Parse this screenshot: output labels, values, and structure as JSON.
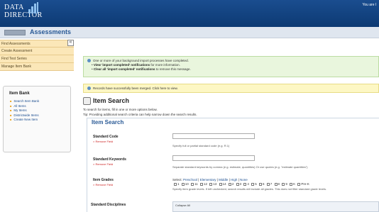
{
  "header": {
    "logo_line1": "DATA",
    "logo_line2": "DIRECTOR",
    "user_text": "You are l"
  },
  "titlebar": {
    "button_label": "",
    "title": "Assessments"
  },
  "sidebar": {
    "items": [
      {
        "label": "Find Assessments"
      },
      {
        "label": "Create Assessment"
      },
      {
        "label": "Find Test Series"
      },
      {
        "label": "Manage Item Bank"
      }
    ],
    "collapse_label": "«",
    "item_bank": {
      "heading": "Item Bank",
      "links": [
        {
          "label": "Search Item Bank"
        },
        {
          "label": "All Items"
        },
        {
          "label": "My Items"
        },
        {
          "label": "Districtwide Items"
        },
        {
          "label": "Create New Item"
        }
      ]
    }
  },
  "notice": {
    "line1": "One or more of your background import processes have completed.",
    "line2_bold": "View 'import completed' notifications",
    "line2_rest": "for more information.",
    "line3_bold": "Clear all 'import completed' notifications",
    "line3_rest": "to remove this message."
  },
  "merged_notice": "Records have successfully been merged. Click here to view.",
  "search": {
    "title": "Item Search",
    "intro1": "To search for items, fill in one or more options below.",
    "intro2": "Tip: Providing additional search criteria can help narrow down the search results.",
    "panel_title": "Item Search",
    "remove_label": "× Remove Field",
    "standard_code": {
      "label": "Standard Code",
      "hint": "Specify full or partial standard code (e.g. R.1)"
    },
    "standard_keywords": {
      "label": "Standard Keywords",
      "hint": "Separate standard keywords by comma (e.g. estimate, quantities) Or use quotes (e.g. \"estimate quantities\")"
    },
    "item_grades": {
      "label": "Item Grades",
      "select_prefix": "Select:",
      "select_links": [
        "Preschool",
        "Elementary",
        "Middle",
        "High",
        "None"
      ],
      "grades": [
        "1",
        "10",
        "11",
        "12",
        "13",
        "14",
        "2",
        "3",
        "4",
        "5",
        "6",
        "7",
        "8",
        "9",
        "K",
        "Pre-K"
      ],
      "hint": "Specify item grade levels. If left unchecked, search results will include all grades. This does not filter standard grade levels."
    },
    "standard_disciplines": {
      "label": "Standard Disciplines",
      "collapse_label": "Collapse All"
    }
  }
}
